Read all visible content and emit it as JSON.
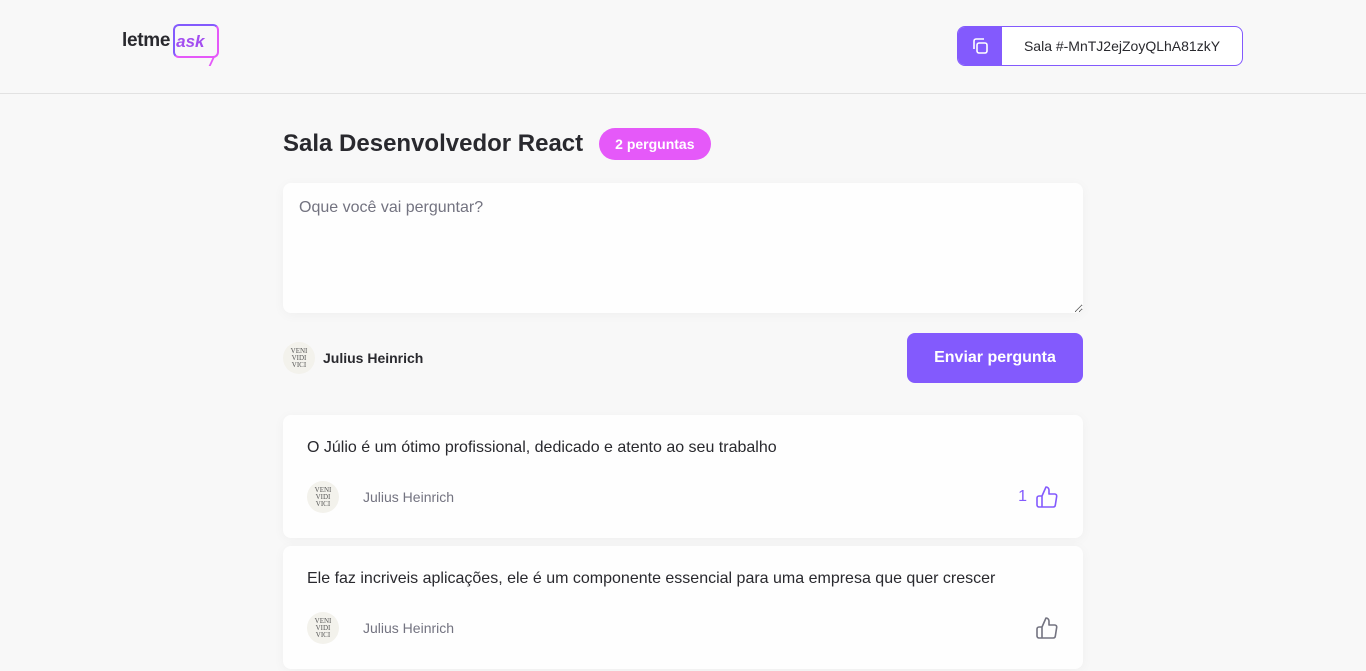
{
  "header": {
    "logo_text": "letme",
    "logo_accent": "ask",
    "room_code": "Sala #-MnTJ2ejZoyQLhA81zkY"
  },
  "room": {
    "title": "Sala Desenvolvedor React",
    "count_badge": "2 perguntas"
  },
  "form": {
    "placeholder": "Oque você vai perguntar?",
    "user_name": "Julius Heinrich",
    "avatar_text": "VENI VIDI VICI",
    "submit_label": "Enviar pergunta"
  },
  "questions": [
    {
      "content": "O Júlio é um ótimo profissional, dedicado e atento ao seu trabalho",
      "author": "Julius Heinrich",
      "likes": "1",
      "liked": true
    },
    {
      "content": "Ele faz incriveis aplicações, ele é um componente essencial para uma empresa que quer crescer",
      "author": "Julius Heinrich",
      "likes": null,
      "liked": false
    }
  ],
  "colors": {
    "purple": "#835afd",
    "pink": "#e559f9"
  }
}
